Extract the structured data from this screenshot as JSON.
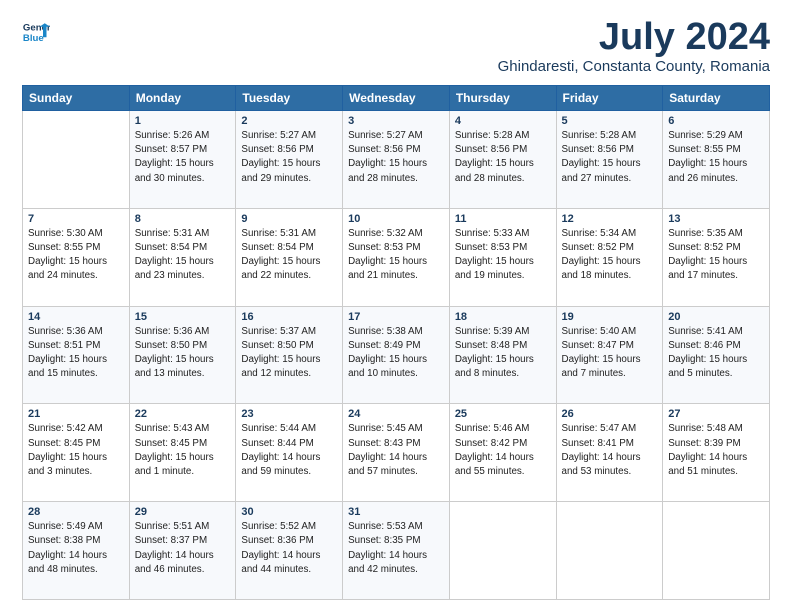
{
  "header": {
    "logo_line1": "General",
    "logo_line2": "Blue",
    "month": "July 2024",
    "location": "Ghindaresti, Constanta County, Romania"
  },
  "weekdays": [
    "Sunday",
    "Monday",
    "Tuesday",
    "Wednesday",
    "Thursday",
    "Friday",
    "Saturday"
  ],
  "weeks": [
    [
      {
        "day": "",
        "info": ""
      },
      {
        "day": "1",
        "info": "Sunrise: 5:26 AM\nSunset: 8:57 PM\nDaylight: 15 hours\nand 30 minutes."
      },
      {
        "day": "2",
        "info": "Sunrise: 5:27 AM\nSunset: 8:56 PM\nDaylight: 15 hours\nand 29 minutes."
      },
      {
        "day": "3",
        "info": "Sunrise: 5:27 AM\nSunset: 8:56 PM\nDaylight: 15 hours\nand 28 minutes."
      },
      {
        "day": "4",
        "info": "Sunrise: 5:28 AM\nSunset: 8:56 PM\nDaylight: 15 hours\nand 28 minutes."
      },
      {
        "day": "5",
        "info": "Sunrise: 5:28 AM\nSunset: 8:56 PM\nDaylight: 15 hours\nand 27 minutes."
      },
      {
        "day": "6",
        "info": "Sunrise: 5:29 AM\nSunset: 8:55 PM\nDaylight: 15 hours\nand 26 minutes."
      }
    ],
    [
      {
        "day": "7",
        "info": "Sunrise: 5:30 AM\nSunset: 8:55 PM\nDaylight: 15 hours\nand 24 minutes."
      },
      {
        "day": "8",
        "info": "Sunrise: 5:31 AM\nSunset: 8:54 PM\nDaylight: 15 hours\nand 23 minutes."
      },
      {
        "day": "9",
        "info": "Sunrise: 5:31 AM\nSunset: 8:54 PM\nDaylight: 15 hours\nand 22 minutes."
      },
      {
        "day": "10",
        "info": "Sunrise: 5:32 AM\nSunset: 8:53 PM\nDaylight: 15 hours\nand 21 minutes."
      },
      {
        "day": "11",
        "info": "Sunrise: 5:33 AM\nSunset: 8:53 PM\nDaylight: 15 hours\nand 19 minutes."
      },
      {
        "day": "12",
        "info": "Sunrise: 5:34 AM\nSunset: 8:52 PM\nDaylight: 15 hours\nand 18 minutes."
      },
      {
        "day": "13",
        "info": "Sunrise: 5:35 AM\nSunset: 8:52 PM\nDaylight: 15 hours\nand 17 minutes."
      }
    ],
    [
      {
        "day": "14",
        "info": "Sunrise: 5:36 AM\nSunset: 8:51 PM\nDaylight: 15 hours\nand 15 minutes."
      },
      {
        "day": "15",
        "info": "Sunrise: 5:36 AM\nSunset: 8:50 PM\nDaylight: 15 hours\nand 13 minutes."
      },
      {
        "day": "16",
        "info": "Sunrise: 5:37 AM\nSunset: 8:50 PM\nDaylight: 15 hours\nand 12 minutes."
      },
      {
        "day": "17",
        "info": "Sunrise: 5:38 AM\nSunset: 8:49 PM\nDaylight: 15 hours\nand 10 minutes."
      },
      {
        "day": "18",
        "info": "Sunrise: 5:39 AM\nSunset: 8:48 PM\nDaylight: 15 hours\nand 8 minutes."
      },
      {
        "day": "19",
        "info": "Sunrise: 5:40 AM\nSunset: 8:47 PM\nDaylight: 15 hours\nand 7 minutes."
      },
      {
        "day": "20",
        "info": "Sunrise: 5:41 AM\nSunset: 8:46 PM\nDaylight: 15 hours\nand 5 minutes."
      }
    ],
    [
      {
        "day": "21",
        "info": "Sunrise: 5:42 AM\nSunset: 8:45 PM\nDaylight: 15 hours\nand 3 minutes."
      },
      {
        "day": "22",
        "info": "Sunrise: 5:43 AM\nSunset: 8:45 PM\nDaylight: 15 hours\nand 1 minute."
      },
      {
        "day": "23",
        "info": "Sunrise: 5:44 AM\nSunset: 8:44 PM\nDaylight: 14 hours\nand 59 minutes."
      },
      {
        "day": "24",
        "info": "Sunrise: 5:45 AM\nSunset: 8:43 PM\nDaylight: 14 hours\nand 57 minutes."
      },
      {
        "day": "25",
        "info": "Sunrise: 5:46 AM\nSunset: 8:42 PM\nDaylight: 14 hours\nand 55 minutes."
      },
      {
        "day": "26",
        "info": "Sunrise: 5:47 AM\nSunset: 8:41 PM\nDaylight: 14 hours\nand 53 minutes."
      },
      {
        "day": "27",
        "info": "Sunrise: 5:48 AM\nSunset: 8:39 PM\nDaylight: 14 hours\nand 51 minutes."
      }
    ],
    [
      {
        "day": "28",
        "info": "Sunrise: 5:49 AM\nSunset: 8:38 PM\nDaylight: 14 hours\nand 48 minutes."
      },
      {
        "day": "29",
        "info": "Sunrise: 5:51 AM\nSunset: 8:37 PM\nDaylight: 14 hours\nand 46 minutes."
      },
      {
        "day": "30",
        "info": "Sunrise: 5:52 AM\nSunset: 8:36 PM\nDaylight: 14 hours\nand 44 minutes."
      },
      {
        "day": "31",
        "info": "Sunrise: 5:53 AM\nSunset: 8:35 PM\nDaylight: 14 hours\nand 42 minutes."
      },
      {
        "day": "",
        "info": ""
      },
      {
        "day": "",
        "info": ""
      },
      {
        "day": "",
        "info": ""
      }
    ]
  ]
}
